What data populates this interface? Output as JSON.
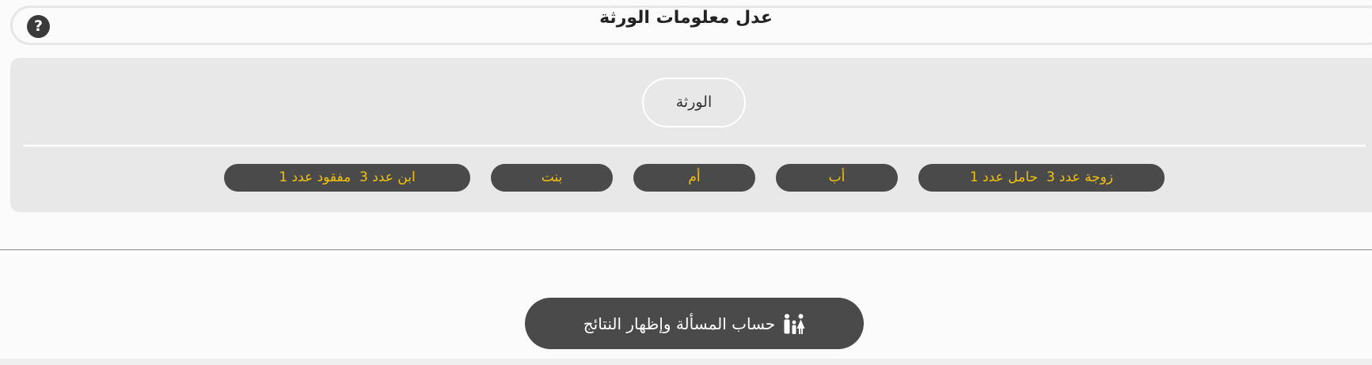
{
  "header": {
    "title": "عدل معلومات الورثة",
    "help_label": "?"
  },
  "heirs_panel": {
    "header_label": "الورثة",
    "chips": [
      "زوجة عدد 3  حامل عدد 1",
      "أب",
      "أم",
      "بنت",
      "ابن عدد 3  مفقود عدد 1"
    ]
  },
  "actions": {
    "calculate_label": "حساب المسألة وإظهار النتائج",
    "calculate_icon": "family-icon"
  },
  "colors": {
    "chip_background": "#4a4a4a",
    "chip_text": "#f3c20a",
    "panel_background": "#e8e8e8",
    "button_background": "#4a4a4a"
  }
}
